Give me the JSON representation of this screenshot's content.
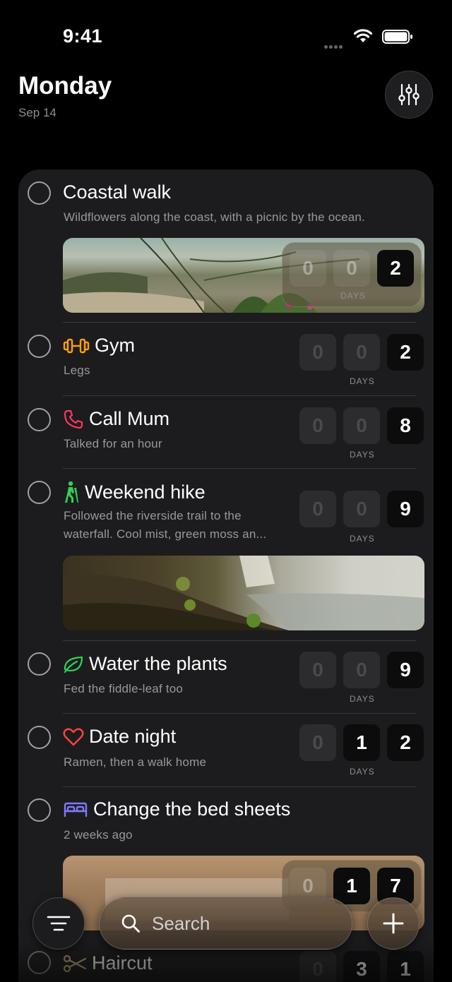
{
  "status": {
    "time": "9:41"
  },
  "header": {
    "title": "Monday",
    "date": "Sep 14"
  },
  "counter_label": "DAYS",
  "items": [
    {
      "title": "Coastal walk",
      "subtitle": "Wildflowers along the coast, with a picnic by the ocean.",
      "digits": [
        "0",
        "0",
        "2"
      ],
      "icon": "none"
    },
    {
      "title": "Gym",
      "subtitle": "Legs",
      "digits": [
        "0",
        "0",
        "2"
      ],
      "icon": "dumbbell-icon",
      "icon_color": "#ff9f0a"
    },
    {
      "title": "Call Mum",
      "subtitle": "Talked for an hour",
      "digits": [
        "0",
        "0",
        "8"
      ],
      "icon": "phone-icon",
      "icon_color": "#ff375f"
    },
    {
      "title": "Weekend hike",
      "subtitle_line1": "Followed the riverside trail to the",
      "subtitle_line2": "waterfall. Cool mist, green moss an...",
      "digits": [
        "0",
        "0",
        "9"
      ],
      "icon": "hiker-icon",
      "icon_color": "#30d158"
    },
    {
      "title": "Water the plants",
      "subtitle": "Fed the fiddle-leaf too",
      "digits": [
        "0",
        "0",
        "9"
      ],
      "icon": "leaf-icon",
      "icon_color": "#30d158"
    },
    {
      "title": "Date night",
      "subtitle": "Ramen, then a walk home",
      "digits": [
        "0",
        "1",
        "2"
      ],
      "icon": "heart-icon",
      "icon_color": "#ff453a"
    },
    {
      "title": "Change the bed sheets",
      "subtitle": "2 weeks ago",
      "digits": [
        "0",
        "1",
        "7"
      ],
      "icon": "bed-icon",
      "icon_color": "#7d7aff"
    },
    {
      "title": "Haircut",
      "digits": [
        "0",
        "3",
        "1"
      ],
      "icon": "scissors-icon",
      "icon_color": "#c7a96b"
    }
  ],
  "search": {
    "placeholder": "Search"
  }
}
